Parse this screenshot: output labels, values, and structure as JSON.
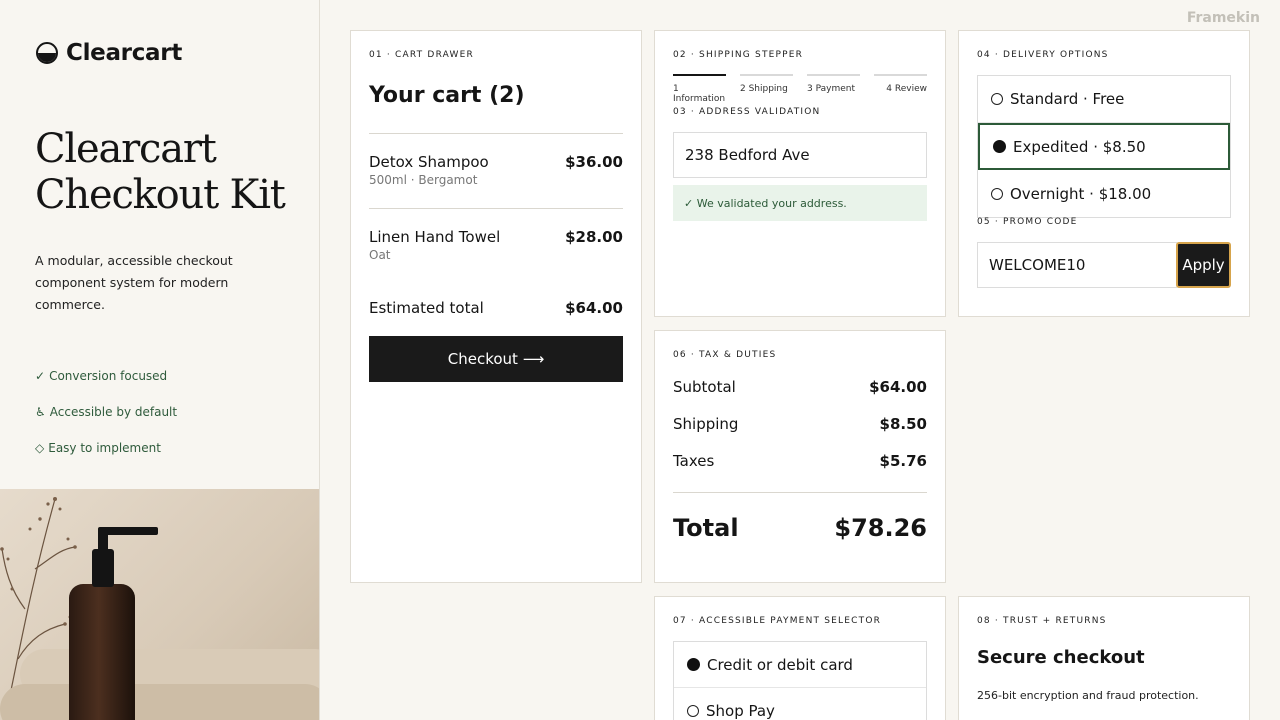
{
  "watermark": "Framekin",
  "brand": {
    "name": "Clearcart"
  },
  "hero": {
    "title": "Clearcart Checkout Kit",
    "description": "A modular, accessible checkout component system for modern commerce."
  },
  "features": [
    {
      "icon": "✓",
      "label": "Conversion focused"
    },
    {
      "icon": "♿",
      "label": "Accessible by default"
    },
    {
      "icon": "◇",
      "label": "Easy to implement"
    }
  ],
  "cart": {
    "section_label": "01 · CART DRAWER",
    "title": "Your cart (2)",
    "items": [
      {
        "name": "Detox Shampoo",
        "variant": "500ml · Bergamot",
        "price": "$36.00"
      },
      {
        "name": "Linen Hand Towel",
        "variant": "Oat",
        "price": "$28.00"
      }
    ],
    "estimated_label": "Estimated total",
    "estimated_value": "$64.00",
    "checkout_label": "Checkout ⟶"
  },
  "shipping": {
    "section_label": "02 · SHIPPING STEPPER",
    "steps": [
      "1 Information",
      "2 Shipping",
      "3 Payment",
      "4 Review"
    ],
    "active_step": 0,
    "address_label": "03 · ADDRESS VALIDATION",
    "address_value": "238 Bedford Ave",
    "validation_message": "✓ We validated your address."
  },
  "delivery": {
    "section_label": "04 · DELIVERY OPTIONS",
    "options": [
      {
        "label": "Standard · Free",
        "selected": false
      },
      {
        "label": "Expedited · $8.50",
        "selected": true
      },
      {
        "label": "Overnight · $18.00",
        "selected": false
      }
    ],
    "promo_label": "05 · PROMO CODE",
    "promo_value": "WELCOME10",
    "apply_label": "Apply"
  },
  "tax": {
    "section_label": "06 · TAX & DUTIES",
    "rows": [
      {
        "label": "Subtotal",
        "value": "$64.00"
      },
      {
        "label": "Shipping",
        "value": "$8.50"
      },
      {
        "label": "Taxes",
        "value": "$5.76"
      }
    ],
    "total_label": "Total",
    "total_value": "$78.26"
  },
  "payment": {
    "section_label": "07 · ACCESSIBLE PAYMENT SELECTOR",
    "options": [
      {
        "label": "Credit or debit card",
        "selected": true
      },
      {
        "label": "Shop Pay",
        "selected": false
      }
    ]
  },
  "trust": {
    "section_label": "08 · TRUST + RETURNS",
    "title": "Secure checkout",
    "description": "256-bit encryption and fraud protection."
  },
  "colors": {
    "background": "#f8f6f1",
    "accent_green": "#2c5a38",
    "button_dark": "#1a1a1a",
    "focus_ring": "#d6a44c"
  }
}
